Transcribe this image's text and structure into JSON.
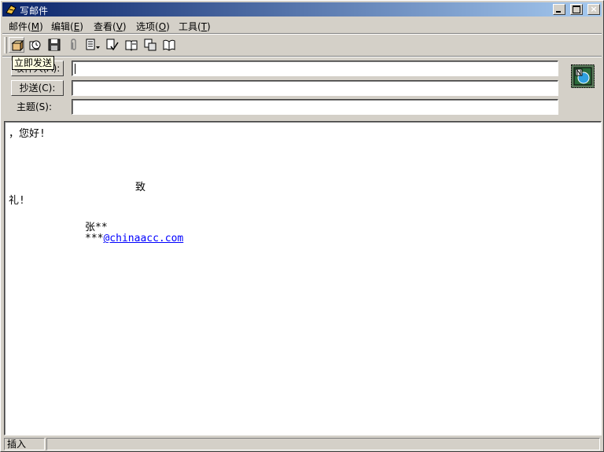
{
  "window": {
    "title": "写邮件",
    "buttons": {
      "minimize": "minimize",
      "maximize": "maximize",
      "close": "×"
    }
  },
  "menu": [
    {
      "label": "邮件",
      "key": "M"
    },
    {
      "label": "编辑",
      "key": "E"
    },
    {
      "label": "查看",
      "key": "V"
    },
    {
      "label": "选项",
      "key": "O"
    },
    {
      "label": "工具",
      "key": "T"
    }
  ],
  "toolbar": {
    "icons": [
      "send-now-icon",
      "send-later-icon",
      "save-icon",
      "attach-icon",
      "format-dropdown-icon",
      "spellcheck-icon",
      "address-book-icon",
      "copy-icon",
      "book-icon"
    ],
    "tooltip": "立即发送"
  },
  "header": {
    "to_button": "收件人(A):",
    "cc_button": "抄送(C):",
    "subject_label": "主题(S):",
    "to_value": "",
    "cc_value": "",
    "subject_value": "",
    "stamp_icon": "mail-stamp-icon"
  },
  "body": {
    "greeting": "，您好!",
    "closing_1": "致",
    "closing_2": "礼!",
    "signature_name": "张**",
    "signature_prefix": "***",
    "signature_link": "@chinaacc.com"
  },
  "status": {
    "mode": "插入"
  }
}
